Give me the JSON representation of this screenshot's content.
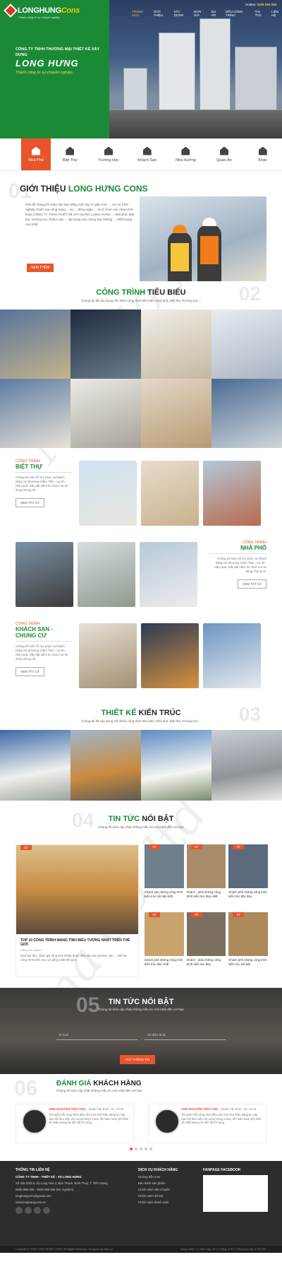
{
  "brand": {
    "name_a": "LONGHUNG",
    "name_b": "Cons",
    "tagline": "Thành công từ sự chuyên nghiệp",
    "company": "CÔNG TY TNHH THƯƠNG MẠI THIẾT KẾ XÂY DỰNG",
    "hero_name": "LONG HƯNG",
    "hero_slogan": "Thành công từ sự chuyên nghiệp",
    "green": "#1b8a36",
    "orange": "#e8542b"
  },
  "topnav": [
    "TRANG CHỦ",
    "GIỚI THIỆU",
    "XÂY DỰNG",
    "ĐƠN GIÁ",
    "DỰ ÁN",
    "MẪU CÔNG TRÌNH",
    "TIN TỨC",
    "LIÊN HỆ"
  ],
  "hotline": {
    "label": "Hotline:",
    "number": "0939 088 055"
  },
  "categories": [
    "Nhà Phố",
    "Biệt Thự",
    "Trường Học",
    "Khách Sạn",
    "Nhà Xưởng",
    "Quán Ăn",
    "Khác"
  ],
  "intro": {
    "num": "01",
    "title_a": "GIỚI THIỆU ",
    "title_b": "LONG HƯNG CONS",
    "text": "Hân đề chúng tôi chào đón bạn bằng một cây cỏ giản mới, ... với sự trình nghiệp chính của công trùng ... sự ... động ngây ... và tổ chức các công trình hoàn CÔNG TY TNHH THIẾT KẾ XÂY DỰNG LONG HƯNG ... Nhà phố, Biệt thự, trường học, khách sạn ... tập trung vào chủng loại những ... chất lượng cao nhất.",
    "button": "XEM THÊM"
  },
  "featured": {
    "num": "02",
    "title_a": "CÔNG TRÌNH ",
    "title_b": "TIÊU BIỂU",
    "sub": "Chúng tôi đã xây dựng rất nhiều công trình tiêu biểu: Nhà phố, Biệt thự Trường học..."
  },
  "category_sections": [
    {
      "label": "CÔNG TRÌNH",
      "title": "BIỆT THỰ",
      "desc": "Chúng tôi luôn nỗ lực phục vụ khách hàng với phương châm Tâm - Uy tín - Hiệu quả. Hãy đặt niềm tin chọn nơi tin dùng chúng tôi.",
      "button": "XEM TẤT CẢ"
    },
    {
      "label": "CÔNG TRÌNH",
      "title": "NHÀ PHỐ",
      "desc": "Chúng tôi luôn nỗ lực phục vụ khách hàng với phương châm Tâm - Uy tín - Hiệu quả. Hãy đặt niềm tin chọn nơi tin dùng chúng tôi.",
      "button": "XEM TẤT CẢ"
    },
    {
      "label": "CÔNG TRÌNH",
      "title": "KHÁCH SẠN - CHUNG CƯ",
      "desc": "Chúng tôi luôn nỗ lực phục vụ khách hàng với phương châm Tâm - Uy tín - Hiệu quả. Hãy đặt niềm tin chọn nơi tin dùng chúng tôi.",
      "button": "XEM TẤT CẢ"
    }
  ],
  "architecture": {
    "num": "03",
    "title_a": "THIẾT KẾ ",
    "title_b": "KIẾN TRÚC",
    "sub": "Chúng tôi đã xây dựng rất nhiều công trình tiêu biểu: Nhà phố, Biệt thự Trường học..."
  },
  "news": {
    "num": "04",
    "title_a": "TIN TỨC ",
    "title_b": "NỔI BẬT",
    "sub": "Chúng tôi luôn cập nhật những mẫu tin mới nhất đến với bạn",
    "big": {
      "date": "07",
      "title": "TOP 10 CÔNG TRÌNH MANG TÍNH BIỂU TƯỢNG NHẤT TRÊN THẾ GIỚI",
      "meta": "Đăng bởi: Admin",
      "desc": "Nhà hát đức, đánh giá tổng kinh khiếp đoàn đàm đài câu Sydney vào ... kiệt tác công trình kiến trúc nổi tiếng nhất thế giới"
    },
    "items": [
      {
        "date": "07",
        "title": "Khách sạn những công trình kiến trúc nổi bật nhất"
      },
      {
        "date": "07",
        "title": "Khách - phải những công trình kiến trúc đẹp nhất"
      },
      {
        "date": "07",
        "title": "Khách phố những công trình kiến trúc độc đáo"
      },
      {
        "date": "07",
        "title": "Khách phố những công trình kiến trúc đẹp nhất"
      },
      {
        "date": "07",
        "title": "Khách - phải những công trình kiến trúc đẹp"
      },
      {
        "date": "07",
        "title": "Khách phố những công trình kiến trúc nổi bật"
      }
    ]
  },
  "newsletter": {
    "num": "05",
    "title": "TIN TỨC NỔI BẬT",
    "sub": "Chúng tôi luôn cập nhật những mẫu tin mới nhất đến với bạn",
    "email_ph": "E-mail",
    "phone_ph": "Số điện thoại",
    "button": "GỬI THÔNG TIN"
  },
  "reviews": {
    "num": "06",
    "title_a": "ĐÁNH GIÁ ",
    "title_b": "KHÁCH HÀNG",
    "sub": "Chúng tôi luôn cập nhật những mẫu tin mới nhất đến với bạn",
    "items": [
      {
        "name": "ANH NGUYỄN HỮU THỌ",
        "place": "- Quận Sài Bình, Tp. HCM",
        "text": "Tôi nghĩ mỗi công trình đều cần một nhà thầu đáng tin cậy. Sau khi làm việc với Long Hưng Cons, tôi hoàn toàn yên tâm về chất lượng và tiến độ thi công."
      },
      {
        "name": "ANH NGUYỄN HỮU THỌ",
        "place": "- Quận Sài Bình, Tp. HCM",
        "text": "Tôi nghĩ mỗi công trình đều cần một nhà thầu đáng tin cậy. Sau khi làm việc với Long Hưng Cons, tôi hoàn toàn yên tâm về chất lượng và tiến độ thi công."
      }
    ]
  },
  "footer": {
    "col1_title": "THÔNG TIN LIÊN HỆ",
    "company": "CÔNG TY TNHH - THIẾT KẾ - XD LONG HƯNG",
    "address": "Số 435 Khối 8, Ấp Long Hòa 2, Bạn Thạch, Bình Thuỷ, T. Tiền Giang",
    "phone": "0939 088 055 - 0939 088 055 (Mr. Nghiệm)",
    "email": "longhungcons@gmail.com",
    "web": "www.longhungcons.vn",
    "col2_title": "DỊCH VỤ KHÁCH HÀNG",
    "col2_items": [
      "Hướng dẫn mua",
      "Bảo hành sản phẩm",
      "Chính sách vận chuyển",
      "Chính sách đổi trả",
      "Chính sách thanh toán"
    ],
    "col3_title": "FANPAGE FACEBOOK",
    "copyright": "Copyright © 2016 LONG HƯNG CONS. All Rights Reserved. Designed by Nina.vn",
    "stats": "Đang online: 4 | Hôm nay: 157 | Tháng: 5.901 | Tổng truy cập: 4.205.951"
  },
  "watermark": "Nina Co.,ltd"
}
